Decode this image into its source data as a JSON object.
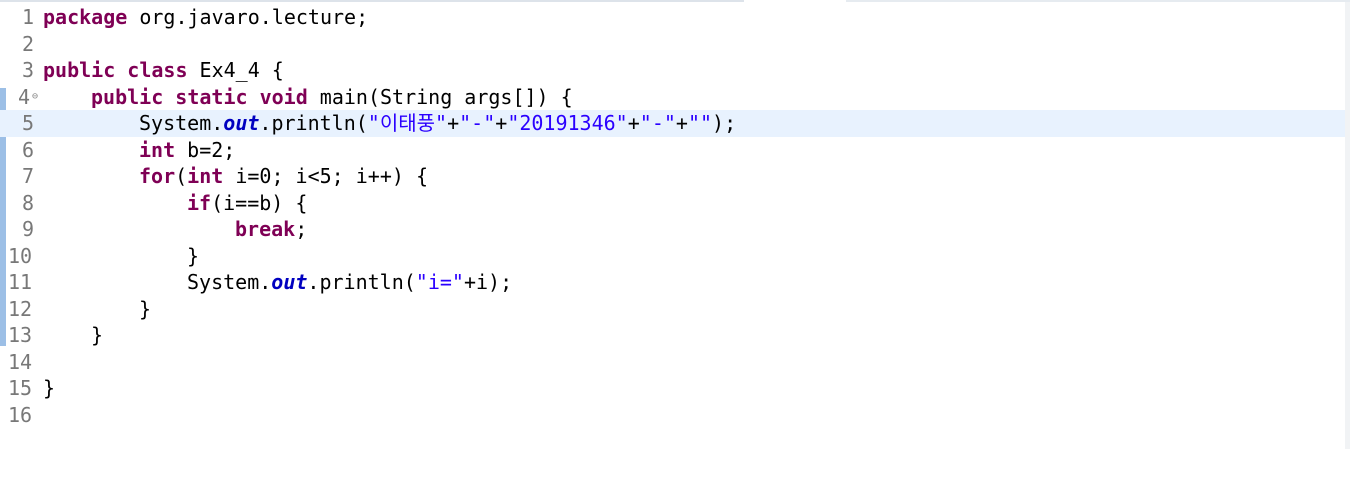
{
  "editor": {
    "lines": [
      {
        "num": "1"
      },
      {
        "num": "2"
      },
      {
        "num": "3"
      },
      {
        "num": "4"
      },
      {
        "num": "5"
      },
      {
        "num": "6"
      },
      {
        "num": "7"
      },
      {
        "num": "8"
      },
      {
        "num": "9"
      },
      {
        "num": "10"
      },
      {
        "num": "11"
      },
      {
        "num": "12"
      },
      {
        "num": "13"
      },
      {
        "num": "14"
      },
      {
        "num": "15"
      },
      {
        "num": "16"
      }
    ],
    "tokens": {
      "l1_kw": "package",
      "l1_rest": " org.javaro.lecture;",
      "l3_kw1": "public",
      "l3_kw2": "class",
      "l3_rest": " Ex4_4 {",
      "l4_kw1": "public",
      "l4_kw2": "static",
      "l4_kw3": "void",
      "l4_rest": " main(String args[]) {",
      "l5_pre": "System.",
      "l5_field": "out",
      "l5_mid": ".println(",
      "l5_s1": "\"이태풍\"",
      "l5_p1": "+",
      "l5_s2": "\"-\"",
      "l5_p2": "+",
      "l5_s3": "\"20191346\"",
      "l5_p3": "+",
      "l5_s4": "\"-\"",
      "l5_p4": "+",
      "l5_s5": "\"\"",
      "l5_end": ");",
      "l6_kw": "int",
      "l6_rest": " b=2;",
      "l7_kw1": "for",
      "l7_p1": "(",
      "l7_kw2": "int",
      "l7_rest": " i=0; i<5; i++) {",
      "l8_kw": "if",
      "l8_rest": "(i==b) {",
      "l9_kw": "break",
      "l9_rest": ";",
      "l10_rest": "}",
      "l11_pre": "System.",
      "l11_field": "out",
      "l11_mid": ".println(",
      "l11_s1": "\"i=\"",
      "l11_end": "+i);",
      "l12_rest": "}",
      "l13_rest": "}",
      "l15_rest": "}"
    },
    "fold_marker": "⊖"
  }
}
